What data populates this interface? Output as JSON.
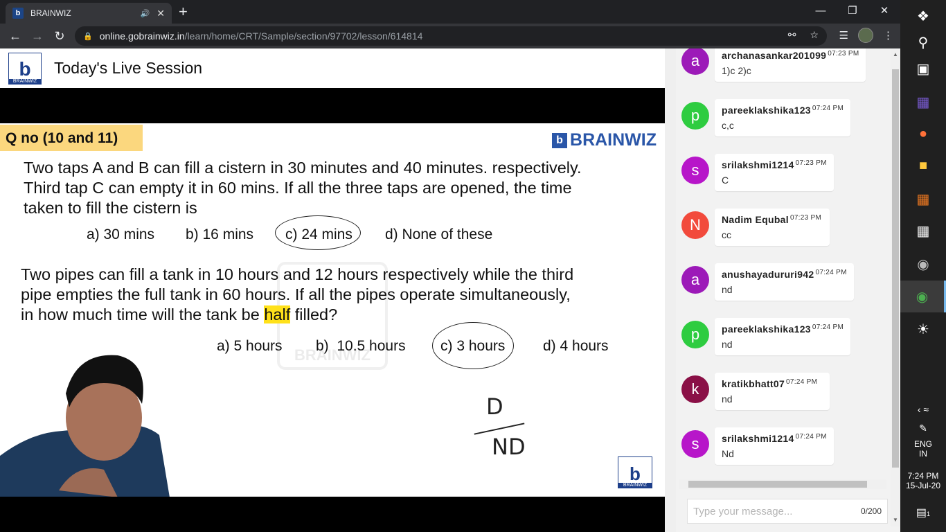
{
  "browser": {
    "tab_title": "BRAINWIZ",
    "tab_favicon": "b",
    "url_host": "online.gobrainwiz.in",
    "url_path": "/learn/home/CRT/Sample/section/97702/lesson/614814"
  },
  "header": {
    "logo_letter": "b",
    "logo_name": "BRAINWIZ",
    "title": "Today's Live Session"
  },
  "slide": {
    "qno": "Q no (10 and 11)",
    "brand": "BRAINWIZ",
    "brand_icon": "b",
    "q1_line1": "Two taps A and B can fill a cistern in 30 minutes and 40 minutes. respectively.",
    "q1_line2": "Third tap C can empty it in 60 mins. If all the three taps are opened, the time",
    "q1_line3": "taken to fill the cistern is",
    "q1_options": [
      "a) 30 mins",
      "b) 16 mins",
      "c) 24 mins",
      "d) None of these"
    ],
    "q2_line1": "Two pipes can fill a tank in 10 hours and 12 hours respectively while the third",
    "q2_line2": "pipe empties the full tank in 60 hours. If all the pipes operate simultaneously,",
    "q2_line3_pre": "in how much time will the tank be ",
    "q2_line3_hl": "half",
    "q2_line3_post": " filled?",
    "q2_options": [
      "a) 5 hours",
      "b)  10.5 hours",
      "c) 3 hours",
      "d) 4 hours"
    ],
    "watermark": "BRAINWIZ",
    "handwriting_top": "D",
    "handwriting_bottom": "ND",
    "corner_logo_letter": "b",
    "corner_logo_name": "BRAINWIZ"
  },
  "chat": {
    "messages": [
      {
        "initial": "a",
        "user": "archanasankar201099",
        "time": "07:23 PM",
        "text": "1)c 2)c",
        "color": "#9c1ab8"
      },
      {
        "initial": "p",
        "user": "pareeklakshika123",
        "time": "07:24 PM",
        "text": "c,c",
        "color": "#2ecc40"
      },
      {
        "initial": "s",
        "user": "srilakshmi1214",
        "time": "07:23 PM",
        "text": "C",
        "color": "#b716c9"
      },
      {
        "initial": "N",
        "user": "Nadim Equbal",
        "time": "07:23 PM",
        "text": "cc",
        "color": "#f24a3c"
      },
      {
        "initial": "a",
        "user": "anushayadururi942",
        "time": "07:24 PM",
        "text": "nd",
        "color": "#9c1ab8"
      },
      {
        "initial": "p",
        "user": "pareeklakshika123",
        "time": "07:24 PM",
        "text": "nd",
        "color": "#2ecc40"
      },
      {
        "initial": "k",
        "user": "kratikbhatt07",
        "time": "07:24 PM",
        "text": "nd",
        "color": "#8a1046"
      },
      {
        "initial": "s",
        "user": "srilakshmi1214",
        "time": "07:24 PM",
        "text": "Nd",
        "color": "#b716c9"
      }
    ],
    "input_placeholder": "Type your message...",
    "char_count": "0/200"
  },
  "taskbar": {
    "lang": "ENG",
    "region": "IN",
    "time": "7:24 PM",
    "date": "15-Jul-20",
    "notification_count": "1"
  }
}
